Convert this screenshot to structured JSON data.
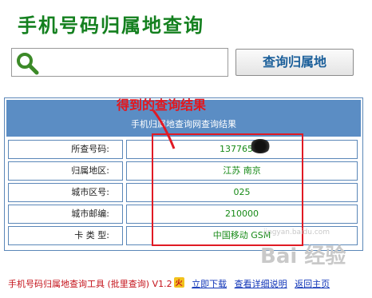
{
  "app": {
    "title": "手机号码归属地查询"
  },
  "search": {
    "value": "",
    "button_label": "查询归属地"
  },
  "results": {
    "header": "手机归属地查询网查询结果",
    "rows": [
      {
        "label": "所查号码:",
        "value": "13776512"
      },
      {
        "label": "归属地区:",
        "value": "江苏 南京"
      },
      {
        "label": "城市区号:",
        "value": "025"
      },
      {
        "label": "城市邮编:",
        "value": "210000"
      },
      {
        "label": "卡 类 型:",
        "value": "中国移动 GSM"
      }
    ]
  },
  "annotation": {
    "text": "得到的查询结果",
    "color": "#e5161b"
  },
  "footer": {
    "tool_name": "手机号码归属地查询工具 (批里查询) V1.2",
    "badge": "火",
    "links": [
      "立即下载",
      "查看详细说明",
      "返回主页"
    ]
  },
  "watermark": {
    "text": "Bai 经验",
    "url": "jingyan.baidu.com"
  },
  "colors": {
    "title": "#14801f",
    "header_bg": "#5b8dc4",
    "value_text": "#178a17",
    "annotation": "#e01a24"
  }
}
